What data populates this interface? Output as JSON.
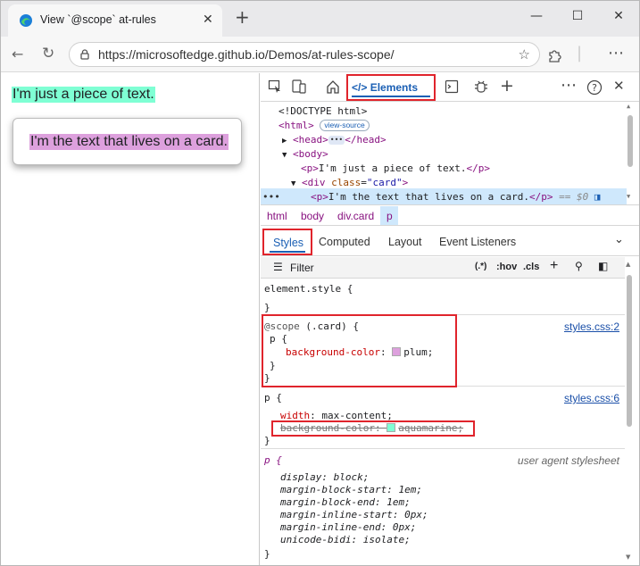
{
  "browser": {
    "tab_title": "View `@scope` at-rules",
    "url": "https://microsoftedge.github.io/Demos/at-rules-scope/"
  },
  "page": {
    "plain_text": "I'm just a piece of text.",
    "card_text": "I'm the text that lives on a card."
  },
  "devtools": {
    "elements_tab": "Elements",
    "dom": {
      "doctype": "<!DOCTYPE html>",
      "html_open": "<html>",
      "view_source": "view-source",
      "head_open": "<head>",
      "head_ellipsis": "•••",
      "head_close": "</head>",
      "body_open": "<body>",
      "p1_open": "<p>",
      "p1_text": "I'm just a piece of text.",
      "p1_close": "</p>",
      "div_open": "<div",
      "div_attr_name": "class",
      "div_attr_value": "\"card\"",
      "div_close_bracket": ">",
      "p2_open": "<p>",
      "p2_text": "I'm the text that lives on a card.",
      "p2_close": "</p>",
      "dollar0": "== $0",
      "gutter_dots": "•••"
    },
    "breadcrumbs": [
      "html",
      "body",
      "div.card",
      "p"
    ],
    "style_tabs": {
      "styles": "Styles",
      "computed": "Computed",
      "layout": "Layout",
      "event_listeners": "Event Listeners"
    },
    "filter": {
      "label": "Filter",
      "regex": "(.*)",
      "hov": ":hov",
      "cls": ".cls"
    },
    "rules": {
      "element_style": {
        "selector": "element.style {",
        "close": "}"
      },
      "scope_rule": {
        "at_rule": "@scope",
        "scope_selector": "(.card) {",
        "inner_selector": "p {",
        "property": "background-color",
        "value": "plum;",
        "inner_close": "}",
        "close": "}",
        "source": "styles.css:2",
        "swatch_color": "#dda0dd"
      },
      "p_rule": {
        "selector": "p {",
        "prop1": "width",
        "val1": "max-content;",
        "prop2": "background-color",
        "val2": "aquamarine;",
        "close": "}",
        "source": "styles.css:6",
        "swatch_color": "#7fffd4"
      },
      "ua_rule": {
        "selector": "p {",
        "source": "user agent stylesheet",
        "declarations": [
          {
            "prop": "display",
            "val": "block;"
          },
          {
            "prop": "margin-block-start",
            "val": "1em;"
          },
          {
            "prop": "margin-block-end",
            "val": "1em;"
          },
          {
            "prop": "margin-inline-start",
            "val": "0px;"
          },
          {
            "prop": "margin-inline-end",
            "val": "0px;"
          },
          {
            "prop": "unicode-bidi",
            "val": "isolate;"
          }
        ],
        "close": "}"
      }
    }
  }
}
